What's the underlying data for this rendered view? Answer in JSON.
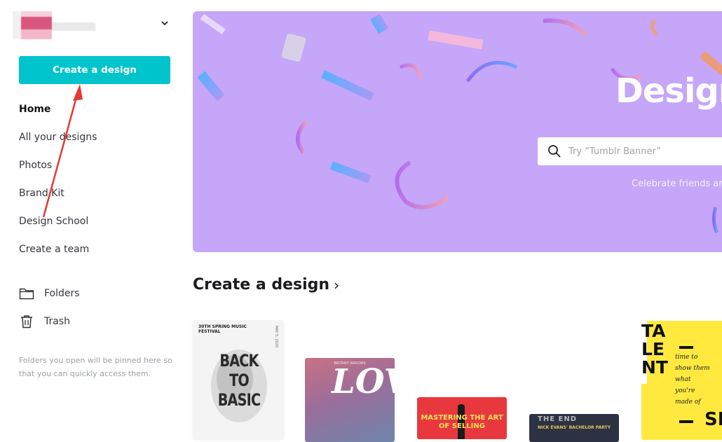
{
  "sidebar": {
    "account_chevron_icon": "chevron-down-icon",
    "create_button_label": "Create a design",
    "nav": [
      {
        "label": "Home",
        "active": true
      },
      {
        "label": "All your designs"
      },
      {
        "label": "Photos"
      },
      {
        "label": "Brand Kit"
      },
      {
        "label": "Design School"
      },
      {
        "label": "Create a team"
      }
    ],
    "folders_label": "Folders",
    "trash_label": "Trash",
    "note": "Folders you open will be pinned here so that you can quickly access them."
  },
  "hero": {
    "title": "Design",
    "search_placeholder": "Try “Tumblr Banner”",
    "subtitle": "Celebrate friends ar",
    "background_color": "#c5a6f8"
  },
  "section": {
    "title": "Create a design",
    "chevron": "›"
  },
  "templates": {
    "card1": {
      "header": "30TH SPRING MUSIC FESTIVAL",
      "big": "BACK TO BASIC",
      "side": "MAY 5, 2020"
    },
    "card2": {
      "small": "BRITANY ARROWS",
      "big": "LOVE"
    },
    "card3": {
      "text": "MASTERING THE ART OF SELLING"
    },
    "card4": {
      "top": "THE END",
      "text": "NICK EVANS' BACHELOR PARTY"
    },
    "card5": {
      "big": "TA LE NT",
      "script": "time to show them what you're made of",
      "tail": "SI"
    }
  },
  "colors": {
    "accent": "#00c4cc",
    "annotation_arrow": "#e53935"
  }
}
